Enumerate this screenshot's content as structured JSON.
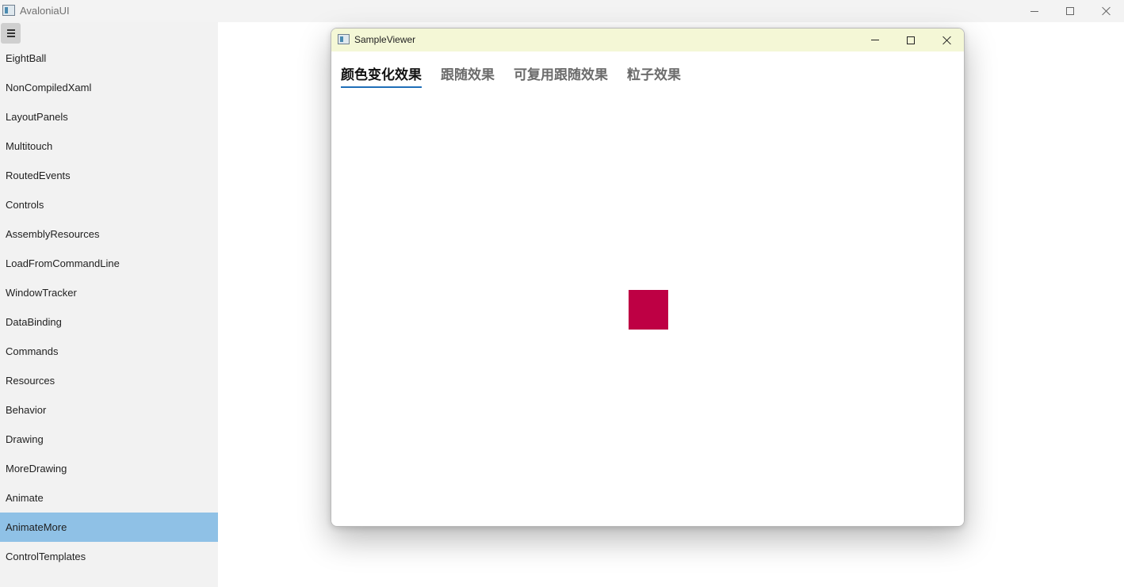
{
  "main_window": {
    "title": "AvaloniaUI",
    "icons": {
      "app": "app-window-icon",
      "minimize": "minimize-icon",
      "maximize": "maximize-icon",
      "close": "close-icon"
    }
  },
  "sidebar": {
    "toggle_icon": "hamburger-menu-icon",
    "items": [
      {
        "label": "EightBall"
      },
      {
        "label": "NonCompiledXaml"
      },
      {
        "label": "LayoutPanels"
      },
      {
        "label": "Multitouch"
      },
      {
        "label": "RoutedEvents"
      },
      {
        "label": "Controls"
      },
      {
        "label": "AssemblyResources"
      },
      {
        "label": "LoadFromCommandLine"
      },
      {
        "label": "WindowTracker"
      },
      {
        "label": "DataBinding"
      },
      {
        "label": "Commands"
      },
      {
        "label": "Resources"
      },
      {
        "label": "Behavior"
      },
      {
        "label": "Drawing"
      },
      {
        "label": "MoreDrawing"
      },
      {
        "label": "Animate"
      },
      {
        "label": "AnimateMore"
      },
      {
        "label": "ControlTemplates"
      }
    ],
    "selected_label": "AnimateMore",
    "selected_color": "#8fc1e6"
  },
  "sample_viewer": {
    "title": "SampleViewer",
    "titlebar_color": "#f4f7d6",
    "tabs": [
      {
        "label": "颜色变化效果"
      },
      {
        "label": "跟随效果"
      },
      {
        "label": "可复用跟随效果"
      },
      {
        "label": "粒子效果"
      }
    ],
    "selected_tab": "颜色变化效果",
    "tab_indicator_color": "#1f6fb8",
    "square_color": "#be0044"
  }
}
